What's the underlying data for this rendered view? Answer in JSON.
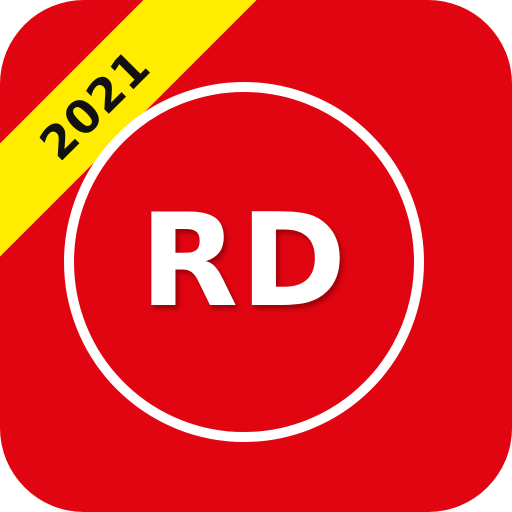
{
  "icon": {
    "background_color": "#e00510",
    "ribbon": {
      "text": "2021",
      "color": "#ffec00",
      "text_color": "#111111"
    },
    "badge": {
      "monogram": "RD",
      "ring_color": "#ffffff",
      "text_color": "#ffffff"
    }
  }
}
